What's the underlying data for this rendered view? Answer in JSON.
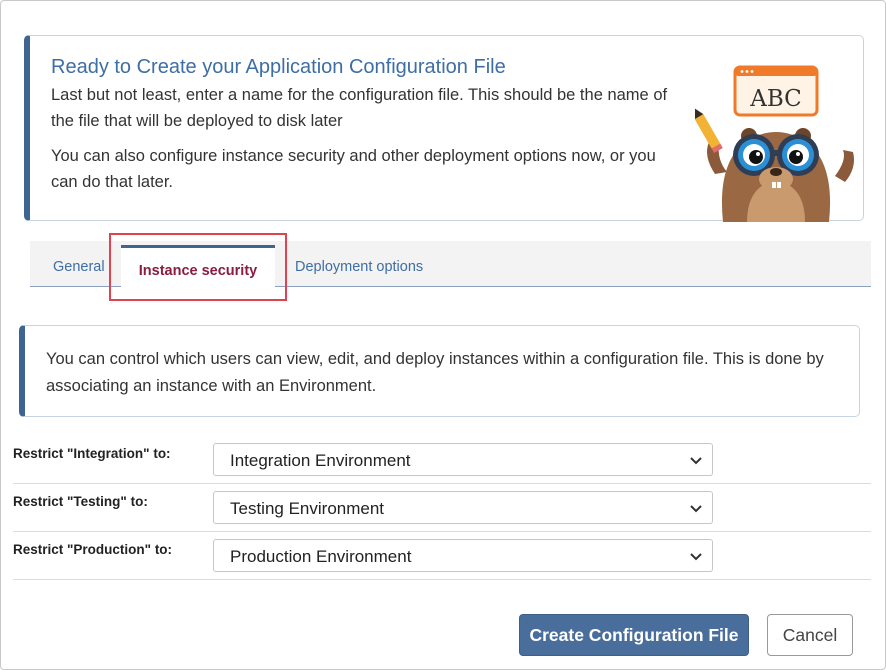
{
  "intro": {
    "title": "Ready to Create your Application Configuration File",
    "paragraph1": "Last but not least, enter a name for the configuration file. This should be the name of the file that will be deployed to disk later",
    "paragraph2": "You can also configure instance security and other deployment options now, or you can do that later.",
    "mascot_sign": "ABC"
  },
  "tabs": {
    "items": [
      "General",
      "Instance security",
      "Deployment options"
    ],
    "active": "Instance security"
  },
  "callout": {
    "text": "You can control which users can view, edit, and deploy instances within a configuration file. This is done by associating an instance with an Environment."
  },
  "restrictions": [
    {
      "label": "Restrict \"Integration\" to:",
      "value": "Integration Environment"
    },
    {
      "label": "Restrict \"Testing\" to:",
      "value": "Testing Environment"
    },
    {
      "label": "Restrict \"Production\" to:",
      "value": "Production Environment"
    }
  ],
  "buttons": {
    "create": "Create Configuration File",
    "cancel": "Cancel"
  },
  "colors": {
    "accent": "#3e6591",
    "title": "#3d6ea6",
    "active_tab_text": "#8b1c3e",
    "highlight": "#e0434f",
    "primary_button": "#4a6e9b"
  }
}
